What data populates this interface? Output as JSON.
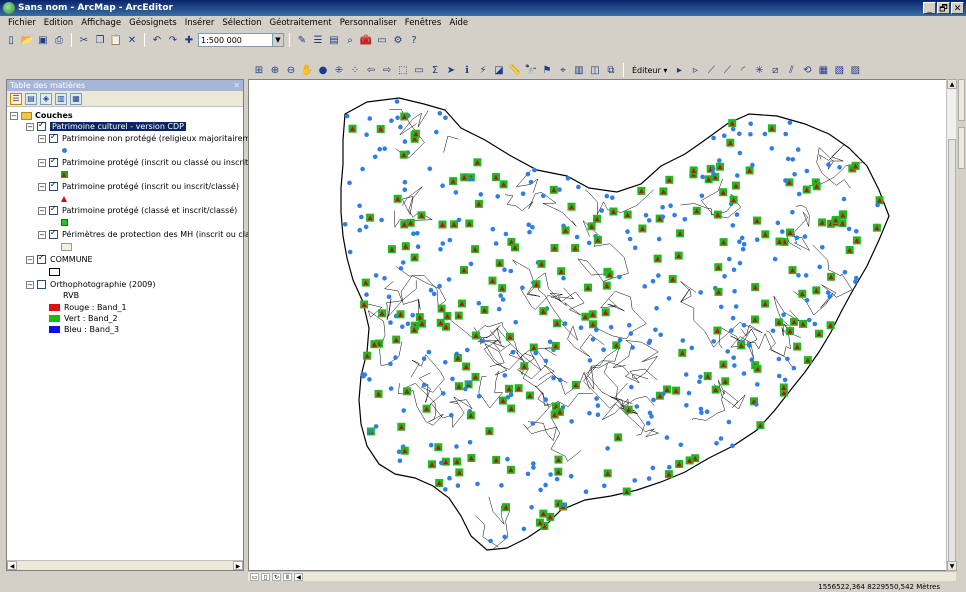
{
  "window": {
    "title": "Sans nom - ArcMap - ArcEditor",
    "controls": [
      "_",
      "🗗",
      "✕"
    ]
  },
  "menu": [
    "Fichier",
    "Edition",
    "Affichage",
    "Géosignets",
    "Insérer",
    "Sélection",
    "Géotraitement",
    "Personnaliser",
    "Fenêtres",
    "Aide"
  ],
  "toolbar": {
    "scale_value": "1:500 000",
    "editor_label": "Éditeur ▾"
  },
  "toc": {
    "header_title": "Table des matières",
    "root_label": "Couches",
    "group_label": "Patrimoine culturel - version CDP",
    "layers": [
      {
        "label": "Patrimoine non protégé (religieux majoritairement)",
        "checked": true,
        "symbol": "dot"
      },
      {
        "label": "Patrimoine protégé (inscrit ou classé ou inscrit/classé)",
        "checked": true,
        "symbol": "sqtri"
      },
      {
        "label": "Patrimoine protégé (inscrit ou inscrit/classé)",
        "checked": true,
        "symbol": "tri"
      },
      {
        "label": "Patrimoine protégé (classé et inscrit/classé)",
        "checked": true,
        "symbol": "sq"
      },
      {
        "label": "Périmètres de protection des MH (inscrit ou classé ou in:",
        "checked": true,
        "symbol": "perim"
      }
    ],
    "commune_label": "COMMUNE",
    "ortho_label": "Orthophotographie (2009)",
    "rvb_label": "RVB",
    "bands": [
      {
        "label": "Rouge : Band_1",
        "color": "#e01010"
      },
      {
        "label": "Vert : Band_2",
        "color": "#10c010"
      },
      {
        "label": "Bleu : Band_3",
        "color": "#1010e0"
      }
    ]
  },
  "colors": {
    "blue_dot": "#2e7de8",
    "green_square": "#22b822",
    "red_triangle": "#c01010",
    "commune_line": "#000000"
  },
  "status": {
    "coordinates": "1556522,364 8229550,542 Mètres"
  }
}
